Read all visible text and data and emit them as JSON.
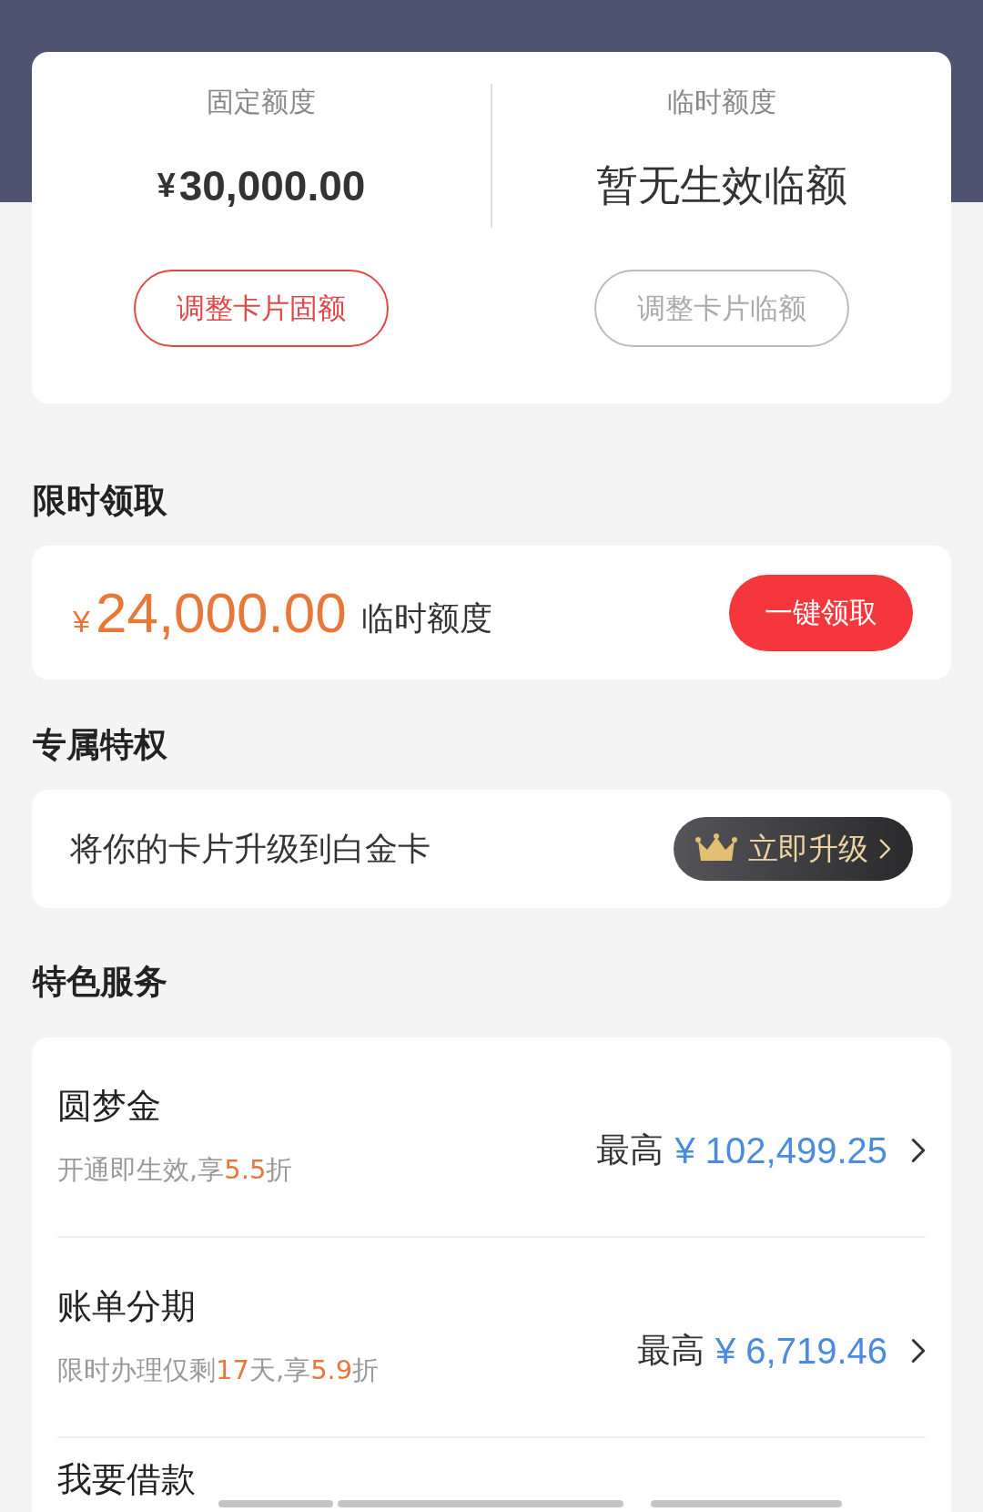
{
  "quota_card": {
    "columns": [
      {
        "label": "固定额度",
        "kind": "amount",
        "currency": "¥",
        "value": "30,000.00",
        "button": {
          "label": "调整卡片固额",
          "disabled": false
        }
      },
      {
        "label": "临时额度",
        "kind": "text",
        "value": "暂无生效临额",
        "button": {
          "label": "调整卡片临额",
          "disabled": true
        }
      }
    ]
  },
  "limited_offer": {
    "title": "限时领取",
    "currency": "¥",
    "amount": "24,000.00",
    "label": "临时额度",
    "button": "一键领取"
  },
  "privilege": {
    "title": "专属特权",
    "text": "将你的卡片升级到白金卡",
    "button": "立即升级"
  },
  "services": {
    "title": "特色服务",
    "items": [
      {
        "name": "圆梦金",
        "subtitle": [
          {
            "text": "开通即生效,享",
            "highlight": false
          },
          {
            "text": "5.5",
            "highlight": true
          },
          {
            "text": "折",
            "highlight": false
          }
        ],
        "max_label": "最高",
        "currency": "¥",
        "amount": "102,499.25"
      },
      {
        "name": "账单分期",
        "subtitle": [
          {
            "text": "限时办理仅剩",
            "highlight": false
          },
          {
            "text": "17",
            "highlight": true
          },
          {
            "text": "天,享",
            "highlight": false
          },
          {
            "text": "5.9",
            "highlight": true
          },
          {
            "text": "折",
            "highlight": false
          }
        ],
        "max_label": "最高",
        "currency": "¥",
        "amount": "6,719.46"
      },
      {
        "name": "我要借款"
      }
    ]
  }
}
